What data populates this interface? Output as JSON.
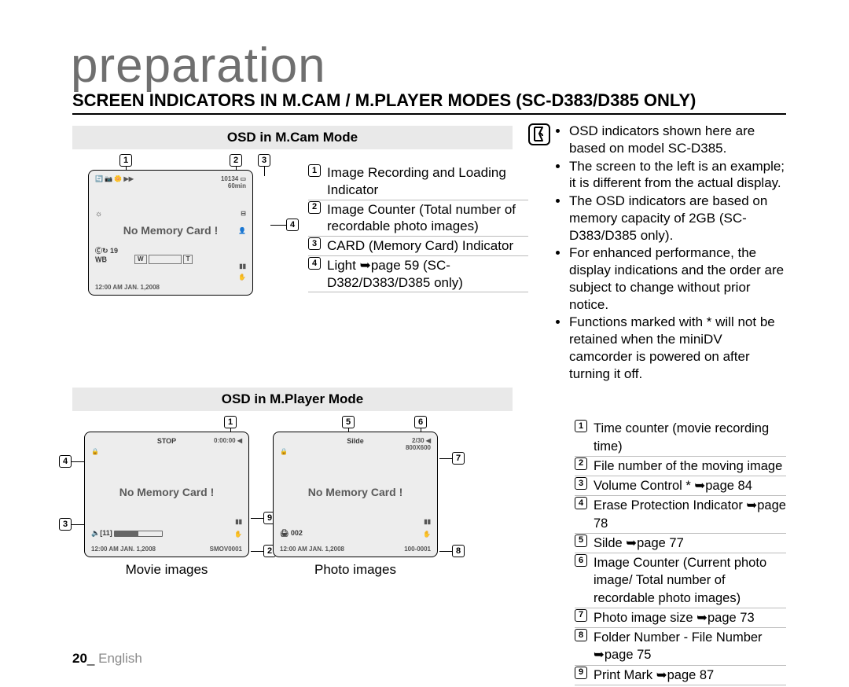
{
  "title": "preparation",
  "section_heading": "SCREEN INDICATORS IN M.CAM / M.PLAYER MODES (SC-D383/D385 ONLY)",
  "subheader_mcam": "OSD in M.Cam Mode",
  "subheader_mplayer": "OSD in M.Player Mode",
  "osd": {
    "no_card": "No Memory Card !",
    "mcam": {
      "tl": "🔄 📷 🌼 ▶▶",
      "tr_count": "10134",
      "tr_time": "60min",
      "ml_sun": "☼",
      "row_cr": "Ⓒ↻ 19",
      "row_wb": "W̲B̲",
      "wt_l": "W",
      "wt_r": "T",
      "blt": "12:00 AM JAN. 1,2008",
      "mr_x": "⊟",
      "mr_person": "👤",
      "mr_batt": "▮▮",
      "mr_hand": "✋"
    },
    "mplayer_movie": {
      "tl_lock": "🔒",
      "tc_stop": "STOP",
      "tr_time": "0:00:00 ◀",
      "ml_vol": "🔈[11]",
      "blt": "12:00 AM JAN. 1,2008",
      "br_file": "SMOV0001",
      "mr_batt": "▮▮",
      "mr_hand": "✋"
    },
    "mplayer_photo": {
      "tl_lock": "🔒",
      "tc_slide": "Silde",
      "tr_count": "2/30 ◀",
      "tr_size": "800X600",
      "ml_print": "🖨 002",
      "blt": "12:00 AM JAN. 1,2008",
      "br_file": "100-0001",
      "mr_batt": "▮▮",
      "mr_hand": "✋"
    }
  },
  "legend_mcam": [
    {
      "n": "1",
      "text": "Image Recording and Loading Indicator"
    },
    {
      "n": "2",
      "text": "Image Counter (Total number of recordable photo images)"
    },
    {
      "n": "3",
      "text": "CARD (Memory Card) Indicator"
    },
    {
      "n": "4",
      "text": "Light  ➥page 59 (SC-D382/D383/D385 only)"
    }
  ],
  "notes": [
    "OSD indicators shown here are based on model SC-D385.",
    "The screen to the left is an example; it is different from the actual display.",
    "The OSD indicators are based on memory capacity of 2GB (SC-D383/D385 only).",
    "For enhanced performance, the display indications and the order are subject to change without prior notice.",
    "Functions marked with * will not be retained when the miniDV camcorder is powered on after turning it off."
  ],
  "captions": {
    "movie": "Movie images",
    "photo": "Photo images"
  },
  "legend_mplayer": [
    {
      "n": "1",
      "text": "Time counter (movie recording time)"
    },
    {
      "n": "2",
      "text": "File number of the moving image"
    },
    {
      "n": "3",
      "text": "Volume Control * ➥page 84"
    },
    {
      "n": "4",
      "text": "Erase Protection Indicator ➥page 78"
    },
    {
      "n": "5",
      "text": "Silde ➥page 77"
    },
    {
      "n": "6",
      "text": "Image Counter (Current photo image/ Total number of recordable photo images)"
    },
    {
      "n": "7",
      "text": "Photo image size ➥page 73"
    },
    {
      "n": "8",
      "text": "Folder Number - File Number ➥page 75"
    },
    {
      "n": "9",
      "text": "Print Mark ➥page 87"
    }
  ],
  "callouts_mcam": {
    "c1": "1",
    "c2": "2",
    "c3": "3",
    "c4": "4"
  },
  "callouts_mplayer_movie": {
    "c1": "1",
    "c2": "2",
    "c3": "3",
    "c4": "4",
    "c9": "9"
  },
  "callouts_mplayer_photo": {
    "c5": "5",
    "c6": "6",
    "c7": "7",
    "c8": "8"
  },
  "footer": {
    "page_num": "20",
    "sep": "_",
    "lang": " English"
  }
}
